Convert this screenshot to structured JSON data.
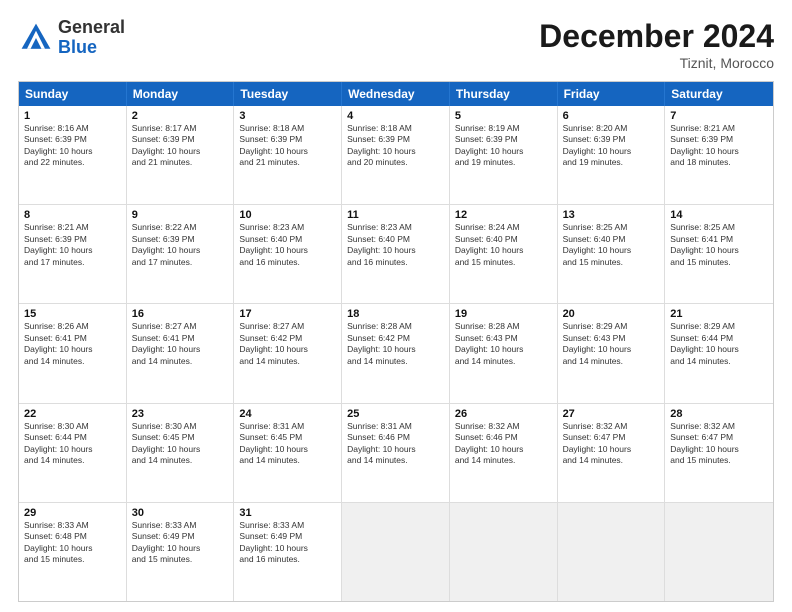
{
  "header": {
    "logo": {
      "general": "General",
      "blue": "Blue"
    },
    "title": "December 2024",
    "location": "Tiznit, Morocco"
  },
  "calendar": {
    "days": [
      "Sunday",
      "Monday",
      "Tuesday",
      "Wednesday",
      "Thursday",
      "Friday",
      "Saturday"
    ],
    "rows": [
      [
        {
          "day": "1",
          "lines": [
            "Sunrise: 8:16 AM",
            "Sunset: 6:39 PM",
            "Daylight: 10 hours",
            "and 22 minutes."
          ]
        },
        {
          "day": "2",
          "lines": [
            "Sunrise: 8:17 AM",
            "Sunset: 6:39 PM",
            "Daylight: 10 hours",
            "and 21 minutes."
          ]
        },
        {
          "day": "3",
          "lines": [
            "Sunrise: 8:18 AM",
            "Sunset: 6:39 PM",
            "Daylight: 10 hours",
            "and 21 minutes."
          ]
        },
        {
          "day": "4",
          "lines": [
            "Sunrise: 8:18 AM",
            "Sunset: 6:39 PM",
            "Daylight: 10 hours",
            "and 20 minutes."
          ]
        },
        {
          "day": "5",
          "lines": [
            "Sunrise: 8:19 AM",
            "Sunset: 6:39 PM",
            "Daylight: 10 hours",
            "and 19 minutes."
          ]
        },
        {
          "day": "6",
          "lines": [
            "Sunrise: 8:20 AM",
            "Sunset: 6:39 PM",
            "Daylight: 10 hours",
            "and 19 minutes."
          ]
        },
        {
          "day": "7",
          "lines": [
            "Sunrise: 8:21 AM",
            "Sunset: 6:39 PM",
            "Daylight: 10 hours",
            "and 18 minutes."
          ]
        }
      ],
      [
        {
          "day": "8",
          "lines": [
            "Sunrise: 8:21 AM",
            "Sunset: 6:39 PM",
            "Daylight: 10 hours",
            "and 17 minutes."
          ]
        },
        {
          "day": "9",
          "lines": [
            "Sunrise: 8:22 AM",
            "Sunset: 6:39 PM",
            "Daylight: 10 hours",
            "and 17 minutes."
          ]
        },
        {
          "day": "10",
          "lines": [
            "Sunrise: 8:23 AM",
            "Sunset: 6:40 PM",
            "Daylight: 10 hours",
            "and 16 minutes."
          ]
        },
        {
          "day": "11",
          "lines": [
            "Sunrise: 8:23 AM",
            "Sunset: 6:40 PM",
            "Daylight: 10 hours",
            "and 16 minutes."
          ]
        },
        {
          "day": "12",
          "lines": [
            "Sunrise: 8:24 AM",
            "Sunset: 6:40 PM",
            "Daylight: 10 hours",
            "and 15 minutes."
          ]
        },
        {
          "day": "13",
          "lines": [
            "Sunrise: 8:25 AM",
            "Sunset: 6:40 PM",
            "Daylight: 10 hours",
            "and 15 minutes."
          ]
        },
        {
          "day": "14",
          "lines": [
            "Sunrise: 8:25 AM",
            "Sunset: 6:41 PM",
            "Daylight: 10 hours",
            "and 15 minutes."
          ]
        }
      ],
      [
        {
          "day": "15",
          "lines": [
            "Sunrise: 8:26 AM",
            "Sunset: 6:41 PM",
            "Daylight: 10 hours",
            "and 14 minutes."
          ]
        },
        {
          "day": "16",
          "lines": [
            "Sunrise: 8:27 AM",
            "Sunset: 6:41 PM",
            "Daylight: 10 hours",
            "and 14 minutes."
          ]
        },
        {
          "day": "17",
          "lines": [
            "Sunrise: 8:27 AM",
            "Sunset: 6:42 PM",
            "Daylight: 10 hours",
            "and 14 minutes."
          ]
        },
        {
          "day": "18",
          "lines": [
            "Sunrise: 8:28 AM",
            "Sunset: 6:42 PM",
            "Daylight: 10 hours",
            "and 14 minutes."
          ]
        },
        {
          "day": "19",
          "lines": [
            "Sunrise: 8:28 AM",
            "Sunset: 6:43 PM",
            "Daylight: 10 hours",
            "and 14 minutes."
          ]
        },
        {
          "day": "20",
          "lines": [
            "Sunrise: 8:29 AM",
            "Sunset: 6:43 PM",
            "Daylight: 10 hours",
            "and 14 minutes."
          ]
        },
        {
          "day": "21",
          "lines": [
            "Sunrise: 8:29 AM",
            "Sunset: 6:44 PM",
            "Daylight: 10 hours",
            "and 14 minutes."
          ]
        }
      ],
      [
        {
          "day": "22",
          "lines": [
            "Sunrise: 8:30 AM",
            "Sunset: 6:44 PM",
            "Daylight: 10 hours",
            "and 14 minutes."
          ]
        },
        {
          "day": "23",
          "lines": [
            "Sunrise: 8:30 AM",
            "Sunset: 6:45 PM",
            "Daylight: 10 hours",
            "and 14 minutes."
          ]
        },
        {
          "day": "24",
          "lines": [
            "Sunrise: 8:31 AM",
            "Sunset: 6:45 PM",
            "Daylight: 10 hours",
            "and 14 minutes."
          ]
        },
        {
          "day": "25",
          "lines": [
            "Sunrise: 8:31 AM",
            "Sunset: 6:46 PM",
            "Daylight: 10 hours",
            "and 14 minutes."
          ]
        },
        {
          "day": "26",
          "lines": [
            "Sunrise: 8:32 AM",
            "Sunset: 6:46 PM",
            "Daylight: 10 hours",
            "and 14 minutes."
          ]
        },
        {
          "day": "27",
          "lines": [
            "Sunrise: 8:32 AM",
            "Sunset: 6:47 PM",
            "Daylight: 10 hours",
            "and 14 minutes."
          ]
        },
        {
          "day": "28",
          "lines": [
            "Sunrise: 8:32 AM",
            "Sunset: 6:47 PM",
            "Daylight: 10 hours",
            "and 15 minutes."
          ]
        }
      ],
      [
        {
          "day": "29",
          "lines": [
            "Sunrise: 8:33 AM",
            "Sunset: 6:48 PM",
            "Daylight: 10 hours",
            "and 15 minutes."
          ]
        },
        {
          "day": "30",
          "lines": [
            "Sunrise: 8:33 AM",
            "Sunset: 6:49 PM",
            "Daylight: 10 hours",
            "and 15 minutes."
          ]
        },
        {
          "day": "31",
          "lines": [
            "Sunrise: 8:33 AM",
            "Sunset: 6:49 PM",
            "Daylight: 10 hours",
            "and 16 minutes."
          ]
        },
        {
          "day": "",
          "lines": []
        },
        {
          "day": "",
          "lines": []
        },
        {
          "day": "",
          "lines": []
        },
        {
          "day": "",
          "lines": []
        }
      ]
    ]
  }
}
